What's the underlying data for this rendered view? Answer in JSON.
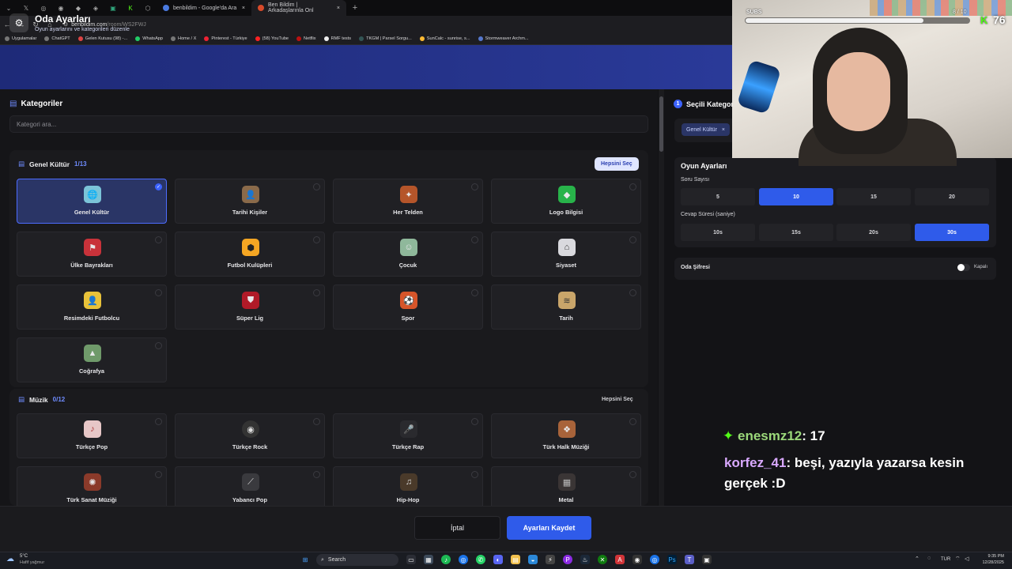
{
  "browser": {
    "tabs": [
      {
        "label": "benbildim - Google'da Ara"
      },
      {
        "label": "Ben Bildim | Arkadaşlarınla Onl"
      }
    ],
    "url_host": "benbildim.com",
    "url_path": "/room/WS2FWJ",
    "bookmarks": [
      "Uygulamalar",
      "ChatGPT",
      "Gelen Kutusu (98) -...",
      "WhatsApp",
      "Home / X",
      "Pinterest - Türkiye",
      "(58) YouTube",
      "Netflix",
      "RMF tests",
      "TKGM | Parsel Sorgu...",
      "SunCalc - sunrise, s...",
      "Stormweaver Archm..."
    ]
  },
  "header": {
    "title": "Oda Ayarları",
    "subtitle": "Oyun ayarlarını ve kategorileri düzenle"
  },
  "categories": {
    "title": "Kategoriler",
    "search_placeholder": "Kategori ara...",
    "groups": [
      {
        "name": "Genel Kültür",
        "count": "1/13",
        "select_all": "Hepsini Seç",
        "items": [
          {
            "label": "Genel Kültür",
            "icon": "globe-icon",
            "selected": true
          },
          {
            "label": "Tarihi Kişiler",
            "icon": "portrait-icon",
            "selected": false
          },
          {
            "label": "Her Telden",
            "icon": "mix-icon",
            "selected": false
          },
          {
            "label": "Logo Bilgisi",
            "icon": "logo-icon",
            "selected": false
          },
          {
            "label": "Ülke Bayrakları",
            "icon": "flag-icon",
            "selected": false
          },
          {
            "label": "Futbol Kulüpleri",
            "icon": "wolf-crest-icon",
            "selected": false
          },
          {
            "label": "Çocuk",
            "icon": "child-icon",
            "selected": false
          },
          {
            "label": "Siyaset",
            "icon": "capitol-icon",
            "selected": false
          },
          {
            "label": "Resimdeki Futbolcu",
            "icon": "footballer-icon",
            "selected": false
          },
          {
            "label": "Süper Lig",
            "icon": "shield-icon",
            "selected": false
          },
          {
            "label": "Spor",
            "icon": "ball-icon",
            "selected": false
          },
          {
            "label": "Tarih",
            "icon": "scroll-icon",
            "selected": false
          },
          {
            "label": "Coğrafya",
            "icon": "map-icon",
            "selected": false
          }
        ]
      },
      {
        "name": "Müzik",
        "count": "0/12",
        "select_all": "Hepsini Seç",
        "items": [
          {
            "label": "Türkçe Pop",
            "icon": "pop-icon",
            "selected": false
          },
          {
            "label": "Türkçe Rock",
            "icon": "record-icon",
            "selected": false
          },
          {
            "label": "Türkçe Rap",
            "icon": "mic-icon",
            "selected": false
          },
          {
            "label": "Türk Halk Müziği",
            "icon": "saz-icon",
            "selected": false
          },
          {
            "label": "Türk Sanat Müziği",
            "icon": "ornament-icon",
            "selected": false
          },
          {
            "label": "Yabancı Pop",
            "icon": "guitar-icon",
            "selected": false
          },
          {
            "label": "Hip-Hop",
            "icon": "hiphop-icon",
            "selected": false
          },
          {
            "label": "Metal",
            "icon": "metal-icon",
            "selected": false
          }
        ]
      }
    ]
  },
  "selected": {
    "number": "1",
    "title": "Seçili Kategori",
    "chips": [
      "Genel Kültür"
    ]
  },
  "game_settings": {
    "title": "Oyun Ayarları",
    "question_count_label": "Soru Sayısı",
    "question_counts": [
      "5",
      "10",
      "15",
      "20"
    ],
    "question_count_selected": "10",
    "answer_time_label": "Cevap Süresi (saniye)",
    "answer_times": [
      "10s",
      "15s",
      "20s",
      "30s"
    ],
    "answer_time_selected": "30s"
  },
  "room_password": {
    "label": "Oda Şifresi",
    "state": "Kapalı"
  },
  "footer": {
    "cancel": "İptal",
    "save": "Ayarları Kaydet"
  },
  "stream": {
    "subs_label": "SUBS",
    "subs_goal": "8 / 10",
    "viewers": "76",
    "chat": [
      {
        "user": "enesmz12",
        "message": ": 17"
      },
      {
        "user": "korfez_41",
        "message": ": beşi, yazıyla yazarsa kesin gerçek :D"
      }
    ]
  },
  "taskbar": {
    "weather_temp": "5°C",
    "weather_desc": "Hafif yağmur",
    "search_label": "Search",
    "lang": "TUR",
    "time": "9:35 PM",
    "date": "12/28/2025"
  },
  "colors": {
    "accent": "#2f5bea",
    "header_gradient_start": "#1e2a78",
    "kick_green": "#53fc18"
  }
}
